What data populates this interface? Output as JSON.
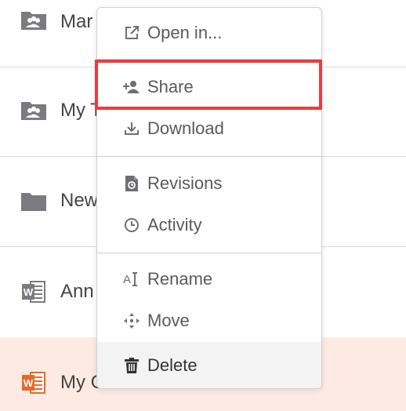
{
  "files": [
    {
      "name": "Mar",
      "icon": "team-folder-icon"
    },
    {
      "name": "My T",
      "icon": "team-folder-icon"
    },
    {
      "name": "New",
      "icon": "folder-icon"
    },
    {
      "name": "Ann",
      "icon": "word-doc-icon"
    },
    {
      "name": "My C",
      "icon": "word-doc-icon"
    }
  ],
  "menu": {
    "open_in": "Open in...",
    "share": "Share",
    "download": "Download",
    "revisions": "Revisions",
    "activity": "Activity",
    "rename": "Rename",
    "move": "Move",
    "delete": "Delete"
  },
  "colors": {
    "selected_row_bg": "#fdebe3",
    "highlight_border": "#ec3b3f",
    "word_selected": "#e8682a",
    "icon_gray": "#6f6f73"
  }
}
